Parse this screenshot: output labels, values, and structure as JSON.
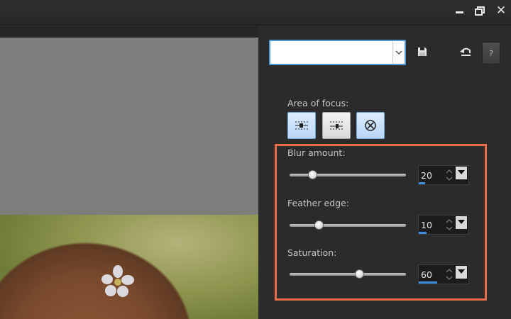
{
  "window": {
    "controls": {
      "minimize": "minimize-icon",
      "restore": "restore-icon",
      "close": "✕"
    }
  },
  "panel": {
    "preset": {
      "value": ""
    },
    "area_of_focus": {
      "label": "Area of focus:",
      "options": [
        {
          "icon": "linear-focus-icon",
          "state": "active"
        },
        {
          "icon": "linear-focus-alt-icon",
          "state": "inactive"
        },
        {
          "icon": "circular-focus-icon",
          "state": "active"
        }
      ]
    },
    "sliders": [
      {
        "label": "Blur amount:",
        "value": "20",
        "level": 0.2
      },
      {
        "label": "Feather edge:",
        "value": "10",
        "level": 0.25
      },
      {
        "label": "Saturation:",
        "value": "60",
        "level": 0.6
      }
    ],
    "colors": {
      "highlight": "#e86b4a",
      "accent": "#3a8fe0",
      "focus_active": "#b9d6f6"
    },
    "help_label": "?"
  }
}
